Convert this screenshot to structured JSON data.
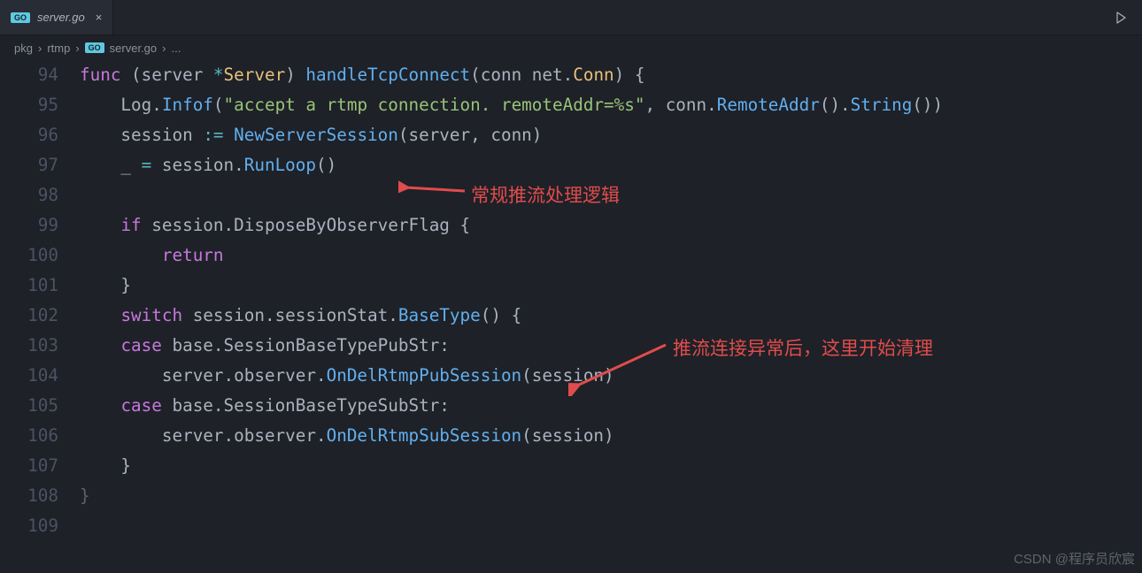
{
  "tab": {
    "filename": "server.go",
    "icon_label": "GO"
  },
  "breadcrumb": {
    "parts": [
      "pkg",
      "rtmp",
      "server.go",
      "..."
    ],
    "go_icon": "GO"
  },
  "lines": [
    {
      "n": 94,
      "tokens": [
        [
          "kw",
          "func"
        ],
        [
          "punct",
          " ("
        ],
        [
          "punct",
          "server "
        ],
        [
          "op",
          "*"
        ],
        [
          "type",
          "Server"
        ],
        [
          "punct",
          ") "
        ],
        [
          "fn",
          "handleTcpConnect"
        ],
        [
          "punct",
          "("
        ],
        [
          "punct",
          "conn net"
        ],
        [
          "punct",
          "."
        ],
        [
          "type",
          "Conn"
        ],
        [
          "punct",
          ") {"
        ]
      ]
    },
    {
      "n": 95,
      "tokens": [
        [
          "punct",
          "    Log."
        ],
        [
          "fn",
          "Infof"
        ],
        [
          "punct",
          "("
        ],
        [
          "str",
          "\"accept a rtmp connection. remoteAddr=%s\""
        ],
        [
          "punct",
          ", conn."
        ],
        [
          "fn",
          "RemoteAddr"
        ],
        [
          "punct",
          "()."
        ],
        [
          "fn",
          "String"
        ],
        [
          "punct",
          "())"
        ]
      ]
    },
    {
      "n": 96,
      "tokens": [
        [
          "punct",
          "    session "
        ],
        [
          "op",
          ":="
        ],
        [
          "punct",
          " "
        ],
        [
          "fn",
          "NewServerSession"
        ],
        [
          "punct",
          "(server, conn)"
        ]
      ]
    },
    {
      "n": 97,
      "tokens": [
        [
          "punct",
          "    _ "
        ],
        [
          "op",
          "="
        ],
        [
          "punct",
          " session."
        ],
        [
          "fn",
          "RunLoop"
        ],
        [
          "punct",
          "()"
        ]
      ]
    },
    {
      "n": 98,
      "tokens": []
    },
    {
      "n": 99,
      "tokens": [
        [
          "punct",
          "    "
        ],
        [
          "kw",
          "if"
        ],
        [
          "punct",
          " session.DisposeByObserverFlag {"
        ]
      ]
    },
    {
      "n": 100,
      "tokens": [
        [
          "punct",
          "        "
        ],
        [
          "kw",
          "return"
        ]
      ]
    },
    {
      "n": 101,
      "tokens": [
        [
          "punct",
          "    }"
        ]
      ]
    },
    {
      "n": 102,
      "tokens": [
        [
          "punct",
          "    "
        ],
        [
          "kw",
          "switch"
        ],
        [
          "punct",
          " session.sessionStat."
        ],
        [
          "fn",
          "BaseType"
        ],
        [
          "punct",
          "() {"
        ]
      ]
    },
    {
      "n": 103,
      "tokens": [
        [
          "punct",
          "    "
        ],
        [
          "kw",
          "case"
        ],
        [
          "punct",
          " base.SessionBaseTypePubStr:"
        ]
      ]
    },
    {
      "n": 104,
      "tokens": [
        [
          "punct",
          "        server.observer."
        ],
        [
          "fn",
          "OnDelRtmpPubSession"
        ],
        [
          "punct",
          "(session)"
        ]
      ]
    },
    {
      "n": 105,
      "tokens": [
        [
          "punct",
          "    "
        ],
        [
          "kw",
          "case"
        ],
        [
          "punct",
          " base.SessionBaseTypeSubStr:"
        ]
      ]
    },
    {
      "n": 106,
      "tokens": [
        [
          "punct",
          "        server.observer."
        ],
        [
          "fn",
          "OnDelRtmpSubSession"
        ],
        [
          "punct",
          "(session)"
        ]
      ]
    },
    {
      "n": 107,
      "tokens": [
        [
          "punct",
          "    }"
        ]
      ]
    },
    {
      "n": 108,
      "tokens": [
        [
          "dim",
          "}"
        ]
      ]
    },
    {
      "n": 109,
      "tokens": []
    }
  ],
  "annotations": {
    "a1": "常规推流处理逻辑",
    "a2": "推流连接异常后，这里开始清理"
  },
  "watermark": "CSDN @程序员欣宸"
}
